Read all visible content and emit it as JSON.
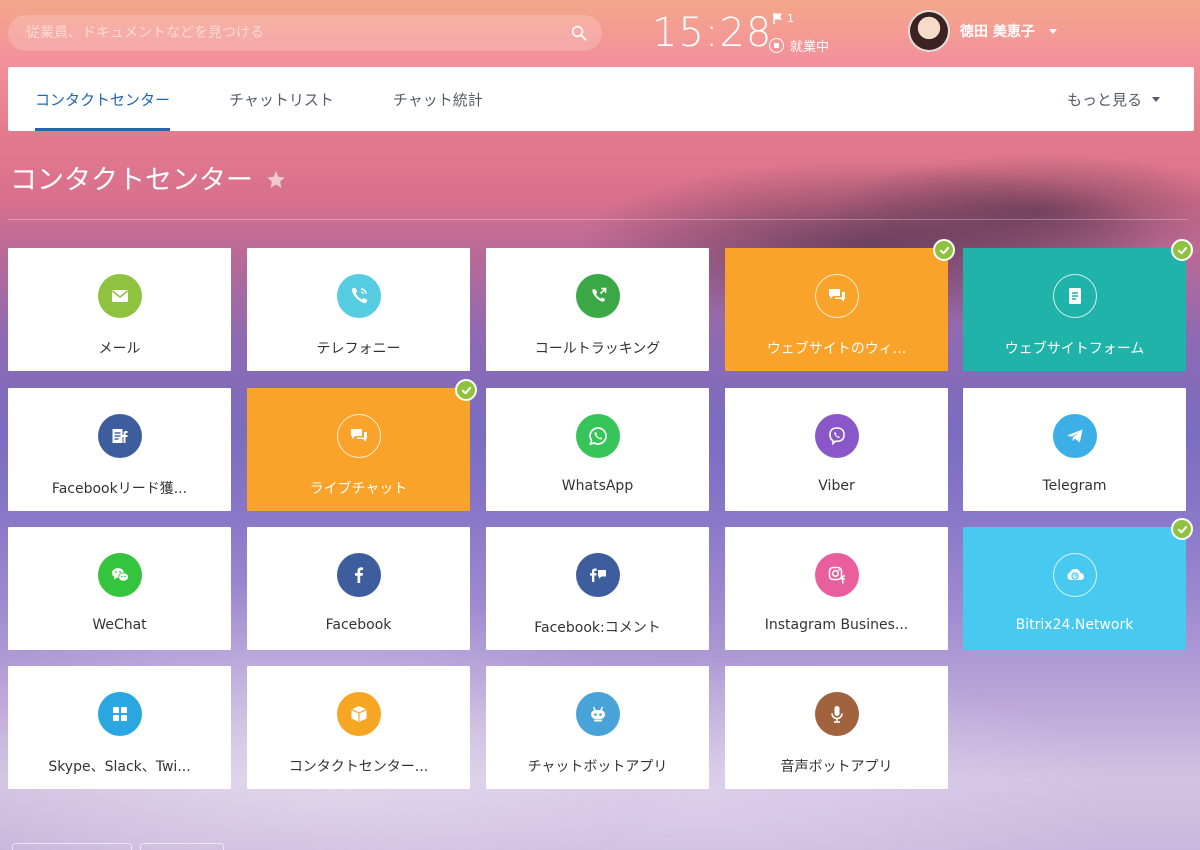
{
  "topbar": {
    "search_placeholder": "従業員、ドキュメントなどを見つける",
    "clock": "15:28",
    "flag_count": "1",
    "work_status": "就業中",
    "user_name": "徳田 美恵子"
  },
  "tabs": [
    {
      "label": "コンタクトセンター",
      "active": true
    },
    {
      "label": "チャットリスト",
      "active": false
    },
    {
      "label": "チャット統計",
      "active": false
    }
  ],
  "tabs_more": "もっと見る",
  "page": {
    "title": "コンタクトセンター"
  },
  "colors": {
    "tile_orange": "#f9a32b",
    "tile_teal": "#20b3a9",
    "tile_sky": "#47c9f0",
    "check_green": "#8fc23f",
    "accent_blue": "#2067b0"
  },
  "tiles": [
    {
      "label": "メール",
      "icon": "mail-icon",
      "icon_color": "#8fc23f",
      "checked": false
    },
    {
      "label": "テレフォニー",
      "icon": "phone-icon",
      "icon_color": "#56cce0",
      "checked": false
    },
    {
      "label": "コールトラッキング",
      "icon": "call-tracking-icon",
      "icon_color": "#3aa845",
      "checked": false
    },
    {
      "label": "ウェブサイトのウィ...",
      "icon": "chat-widget-icon",
      "tile_color": "#f9a32b",
      "checked": true
    },
    {
      "label": "ウェブサイトフォーム",
      "icon": "form-icon",
      "tile_color": "#20b3a9",
      "checked": true
    },
    {
      "label": "Facebookリード獲...",
      "icon": "facebook-leads-icon",
      "icon_color": "#3d5d9c",
      "checked": false
    },
    {
      "label": "ライブチャット",
      "icon": "live-chat-icon",
      "tile_color": "#f9a32b",
      "checked": true
    },
    {
      "label": "WhatsApp",
      "icon": "whatsapp-icon",
      "icon_color": "#37c55a",
      "checked": false
    },
    {
      "label": "Viber",
      "icon": "viber-icon",
      "icon_color": "#8a57c9",
      "checked": false
    },
    {
      "label": "Telegram",
      "icon": "telegram-icon",
      "icon_color": "#3cb0e6",
      "checked": false
    },
    {
      "label": "WeChat",
      "icon": "wechat-icon",
      "icon_color": "#34c43d",
      "checked": false
    },
    {
      "label": "Facebook",
      "icon": "facebook-icon",
      "icon_color": "#3d5d9c",
      "checked": false
    },
    {
      "label": "Facebook:コメント",
      "icon": "facebook-comments-icon",
      "icon_color": "#3d5d9c",
      "checked": false
    },
    {
      "label": "Instagram Busines...",
      "icon": "instagram-icon",
      "icon_color": "#e95e9c",
      "checked": false
    },
    {
      "label": "Bitrix24.Network",
      "icon": "network-icon",
      "tile_color": "#47c9f0",
      "checked": true
    },
    {
      "label": "Skype、Slack、Twi...",
      "icon": "apps-grid-icon",
      "icon_color": "#2aa7e0",
      "checked": false
    },
    {
      "label": "コンタクトセンター...",
      "icon": "box-icon",
      "icon_color": "#f5a623",
      "checked": false
    },
    {
      "label": "チャットボットアプリ",
      "icon": "chatbot-icon",
      "icon_color": "#4aa3d8",
      "checked": false
    },
    {
      "label": "音声ボットアプリ",
      "icon": "microphone-icon",
      "icon_color": "#a0633e",
      "checked": false
    }
  ]
}
